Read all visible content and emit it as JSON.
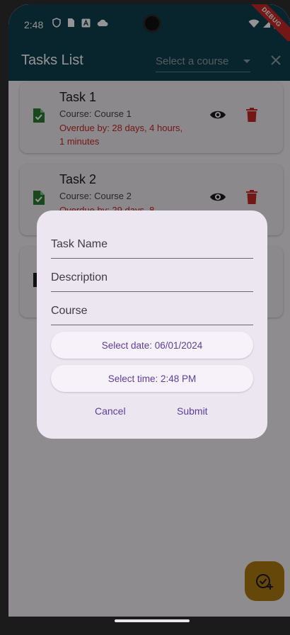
{
  "status_bar": {
    "time": "2:48",
    "left_icons": [
      "shield-icon",
      "sim-card-icon",
      "a-badge-icon",
      "cloud-icon"
    ],
    "right_icons": [
      "wifi-icon",
      "signal-icon",
      "battery-icon"
    ]
  },
  "debug_banner": "DEBUG",
  "app_bar": {
    "title": "Tasks List",
    "course_dropdown": "Select a course",
    "close_icon": "close-icon"
  },
  "tasks": [
    {
      "title": "Task 1",
      "course": "Course: Course 1",
      "overdue": "Overdue by: 28 days, 4 hours, 1 minutes"
    },
    {
      "title": "Task 2",
      "course": "Course: Course 2",
      "overdue": "Overdue by: 29 days, 8"
    }
  ],
  "dialog": {
    "task_name_placeholder": "Task Name",
    "description_placeholder": "Description",
    "course_placeholder": "Course",
    "select_date_label": "Select date: 06/01/2024",
    "select_time_label": "Select time: 2:48 PM",
    "cancel_label": "Cancel",
    "submit_label": "Submit"
  },
  "colors": {
    "app_bar": "#0f3e4e",
    "accent": "#5b3e9e",
    "overdue": "#c62828",
    "file_icon": "#2e7d32",
    "delete_icon": "#c62828",
    "fab": "#b07a12"
  },
  "fab_icon": "add-task-icon"
}
